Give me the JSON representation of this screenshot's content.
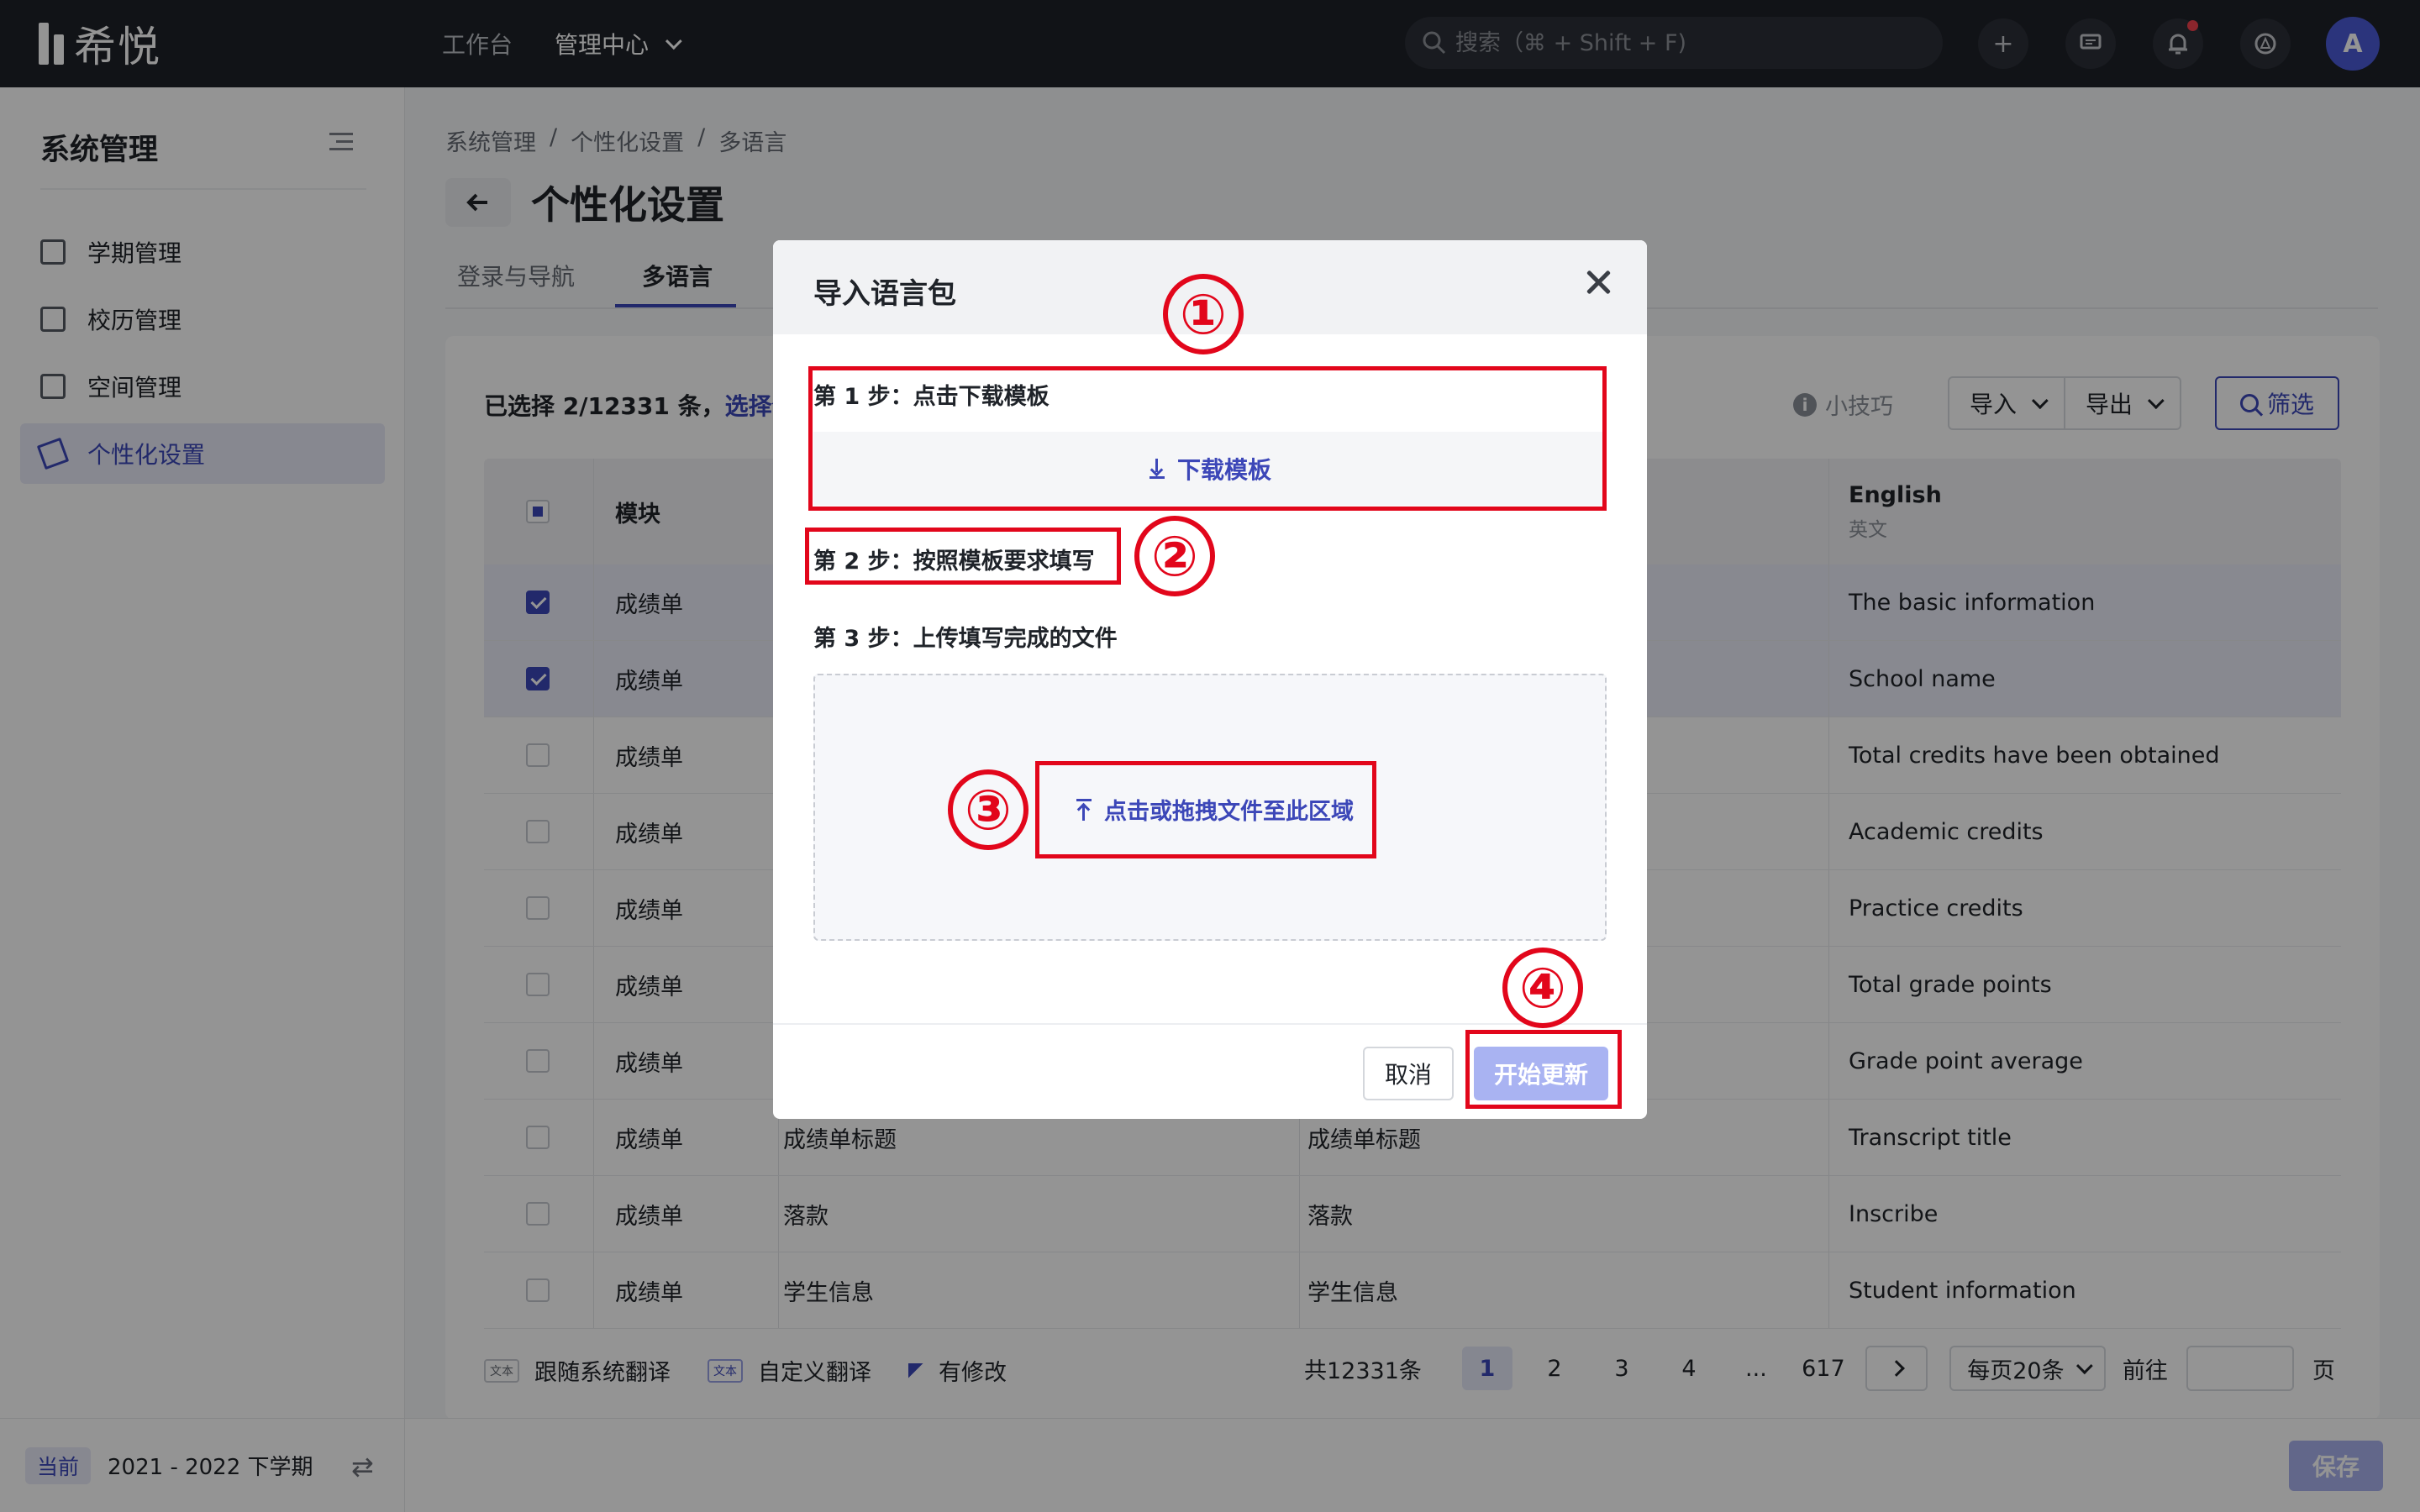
{
  "topbar": {
    "logo_text": "希悦",
    "nav": [
      "工作台",
      "管理中心"
    ],
    "search_placeholder": "搜索（⌘ + Shift + F)",
    "avatar_initial": "A"
  },
  "sidebar": {
    "title": "系统管理",
    "items": [
      {
        "label": "学期管理",
        "icon": "calendar-icon"
      },
      {
        "label": "校历管理",
        "icon": "calendar-grid-icon"
      },
      {
        "label": "空间管理",
        "icon": "cube-icon"
      },
      {
        "label": "个性化设置",
        "icon": "brush-icon",
        "active": true
      }
    ],
    "current_badge": "当前",
    "term": "2021 - 2022 下学期"
  },
  "breadcrumb": [
    "系统管理",
    "/",
    "个性化设置",
    "/",
    "多语言"
  ],
  "page_title": "个性化设置",
  "tabs": [
    {
      "label": "登录与导航"
    },
    {
      "label": "多语言",
      "active": true
    }
  ],
  "toolbar": {
    "selection_prefix": "已选择 2/12331 条，",
    "selection_link": "选择全",
    "tips": "小技巧",
    "import": "导入",
    "export": "导出",
    "filter": "筛选"
  },
  "table": {
    "header": {
      "module": "模块",
      "english": "English",
      "english_sub": "英文"
    },
    "rows": [
      {
        "module": "成绩单",
        "col2": "",
        "col3": "",
        "english": "The basic information",
        "checked": true
      },
      {
        "module": "成绩单",
        "col2": "",
        "col3": "",
        "english": "School name",
        "checked": true
      },
      {
        "module": "成绩单",
        "col2": "",
        "col3": "",
        "english": "Total credits have been obtained",
        "checked": false
      },
      {
        "module": "成绩单",
        "col2": "",
        "col3": "",
        "english": "Academic credits",
        "checked": false
      },
      {
        "module": "成绩单",
        "col2": "",
        "col3": "",
        "english": "Practice credits",
        "checked": false
      },
      {
        "module": "成绩单",
        "col2": "",
        "col3": "",
        "english": "Total grade points",
        "checked": false
      },
      {
        "module": "成绩单",
        "col2": "",
        "col3": "",
        "english": "Grade point average",
        "checked": false
      },
      {
        "module": "成绩单",
        "col2": "成绩单标题",
        "col3": "成绩单标题",
        "english": "Transcript title",
        "checked": false
      },
      {
        "module": "成绩单",
        "col2": "落款",
        "col3": "落款",
        "english": "Inscribe",
        "checked": false
      },
      {
        "module": "成绩单",
        "col2": "学生信息",
        "col3": "学生信息",
        "english": "Student information",
        "checked": false
      }
    ]
  },
  "legend": {
    "tag_text": "文本",
    "follow_system": "跟随系统翻译",
    "custom": "自定义翻译",
    "modified": "有修改"
  },
  "pager": {
    "total": "共12331条",
    "pages": [
      "1",
      "2",
      "3",
      "4",
      "...",
      "617"
    ],
    "per_page": "每页20条",
    "goto": "前往",
    "page_unit": "页"
  },
  "save": "保存",
  "modal": {
    "title": "导入语言包",
    "step1": "第 1 步：点击下载模板",
    "download": "下载模板",
    "step2": "第 2 步：按照模板要求填写",
    "step3": "第 3 步：上传填写完成的文件",
    "upload": "点击或拖拽文件至此区域",
    "cancel": "取消",
    "start": "开始更新"
  },
  "annotations": [
    "①",
    "②",
    "③",
    "④"
  ],
  "colors": {
    "accent": "#3c47b8",
    "annotation_red": "#e2061b",
    "topbar": "#1e2128"
  }
}
